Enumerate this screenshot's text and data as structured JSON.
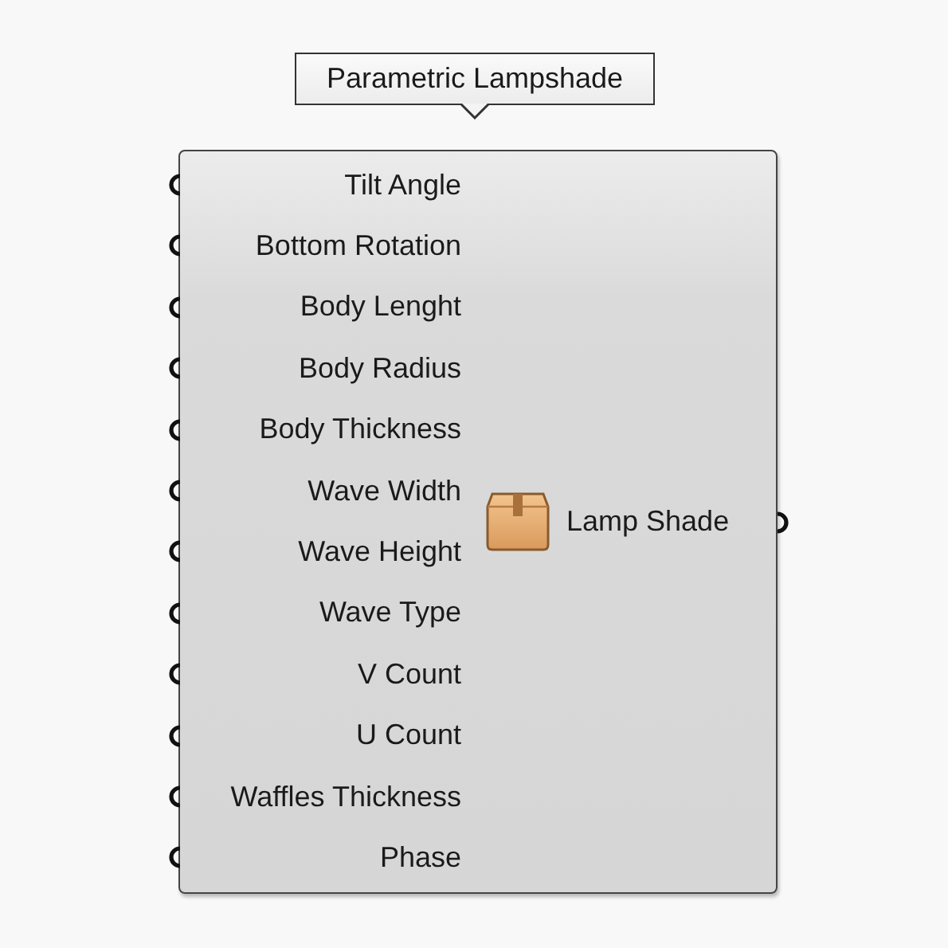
{
  "component": {
    "title": "Parametric Lampshade",
    "inputs": [
      "Tilt Angle",
      "Bottom Rotation",
      "Body Lenght",
      "Body Radius",
      "Body Thickness",
      "Wave Width",
      "Wave Height",
      "Wave Type",
      "V Count",
      "U Count",
      "Waffles Thickness",
      "Phase"
    ],
    "outputs": [
      "Lamp Shade"
    ]
  }
}
